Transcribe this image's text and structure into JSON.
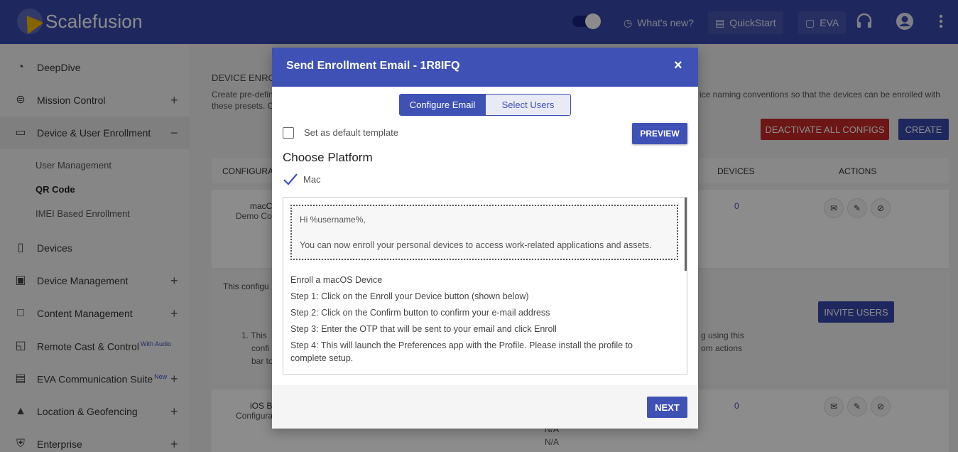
{
  "app": {
    "name": "Scalefusion"
  },
  "topbar": {
    "whats_new": "What's new?",
    "quickstart": "QuickStart",
    "eva": "EVA"
  },
  "sidebar": {
    "items": [
      {
        "label": "DeepDive",
        "icon": "speedometer-icon"
      },
      {
        "label": "Mission Control",
        "icon": "mission-icon",
        "expandable": "+"
      },
      {
        "label": "Device & User Enrollment",
        "icon": "devices-icon",
        "expandable": "−"
      },
      {
        "label": "Devices",
        "icon": "phone-icon"
      },
      {
        "label": "Device Management",
        "icon": "briefcase-icon",
        "expandable": "+"
      },
      {
        "label": "Content Management",
        "icon": "folder-icon",
        "expandable": "+"
      },
      {
        "label": "Remote Cast & Control",
        "icon": "cast-icon",
        "badge": "With Audio"
      },
      {
        "label": "EVA Communication Suite",
        "icon": "chat-icon",
        "badge": "New",
        "expandable": "+"
      },
      {
        "label": "Location & Geofencing",
        "icon": "map-icon",
        "expandable": "+"
      },
      {
        "label": "Enterprise",
        "icon": "shield-icon",
        "expandable": "+"
      }
    ],
    "subitems": [
      "User Management",
      "QR Code",
      "IMEI Based Enrollment"
    ]
  },
  "background": {
    "section_title": "DEVICE ENRO",
    "desc1": "Create pre-defin",
    "desc1b": "ice naming conventions so that the devices can be enrolled with",
    "desc2": "these presets. C",
    "deactivate": "DEACTIVATE ALL CONFIGS",
    "create": "CREATE",
    "col_config": "CONFIGURAT",
    "col_devices": "DEVICES",
    "col_actions": "ACTIONS",
    "row1_name": "macC",
    "row1_sub": "Demo Co",
    "row1_devices": "0",
    "this_config": "This configu",
    "invite": "INVITE USERS",
    "note1a": "1. This",
    "note1b": "g using this",
    "note2a": "confi",
    "note2b": "om actions",
    "note3": "bar to",
    "row2_name": "iOS B",
    "row2_sub": "Configura",
    "row2_devices": "0",
    "na1": "N/A",
    "na2": "N/A"
  },
  "modal": {
    "title": "Send Enrollment Email - 1R8IFQ",
    "close": "×",
    "tab_configure": "Configure Email",
    "tab_select": "Select Users",
    "default_template": "Set as default template",
    "preview": "PREVIEW",
    "choose_platform": "Choose Platform",
    "platform": "Mac",
    "greeting": "Hi %username%,",
    "greeting_body": "You can now enroll your personal devices to access work-related applications and assets.",
    "lines": [
      "Enroll a macOS Device",
      "Step 1: Click on the Enroll your Device button (shown below)",
      "Step 2: Click on the Confirm button to confirm your e-mail address",
      "Step 3: Enter the OTP that will be sent to your email and click Enroll",
      "Step 4: This will launch the Preferences app with the Profile. Please install the profile to",
      "complete setup."
    ],
    "next": "NEXT"
  }
}
